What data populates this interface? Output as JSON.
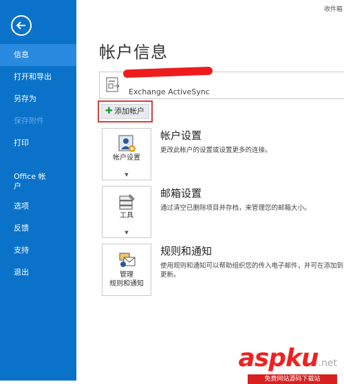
{
  "sidebar": {
    "items": [
      {
        "label": "信息",
        "state": "active"
      },
      {
        "label": "打开和导出",
        "state": "normal"
      },
      {
        "label": "另存为",
        "state": "normal"
      },
      {
        "label": "保存附件",
        "state": "disabled"
      },
      {
        "label": "打印",
        "state": "normal"
      },
      {
        "label": "Office 帐户",
        "state": "normal"
      },
      {
        "label": "选项",
        "state": "normal"
      },
      {
        "label": "反馈",
        "state": "normal"
      },
      {
        "label": "支持",
        "state": "normal"
      },
      {
        "label": "退出",
        "state": "normal"
      }
    ],
    "color": "#0a72c9",
    "active_color": "#2a8ae0"
  },
  "top_right_text": "收件箱",
  "page": {
    "title": "帐户信息"
  },
  "account": {
    "type": "Exchange ActiveSync",
    "name_redacted": true
  },
  "add_account": {
    "label": "添加帐户",
    "highlight_color": "#d93a3a"
  },
  "sections": [
    {
      "tile_label": "帐户设置",
      "title": "帐户设置",
      "description": "更改此帐户的设置或设置更多的连接。",
      "icon": "user-gear-icon"
    },
    {
      "tile_label": "工具",
      "title": "邮箱设置",
      "description": "通过清空已删除项目并存档，来管理您的邮箱大小。",
      "icon": "mailbox-tools-icon"
    },
    {
      "tile_label": "管理规则和通知",
      "tile_label_line1": "管理",
      "tile_label_line2": "规则和通知",
      "title": "规则和通知",
      "description": "使用规则和通知可以帮助组织您的传入电子邮件，并可在添加到更新。",
      "icon": "rules-icon"
    }
  ],
  "watermark": {
    "brand": "aspku",
    "suffix": ".net",
    "sub": "免费网站源码下载站"
  }
}
